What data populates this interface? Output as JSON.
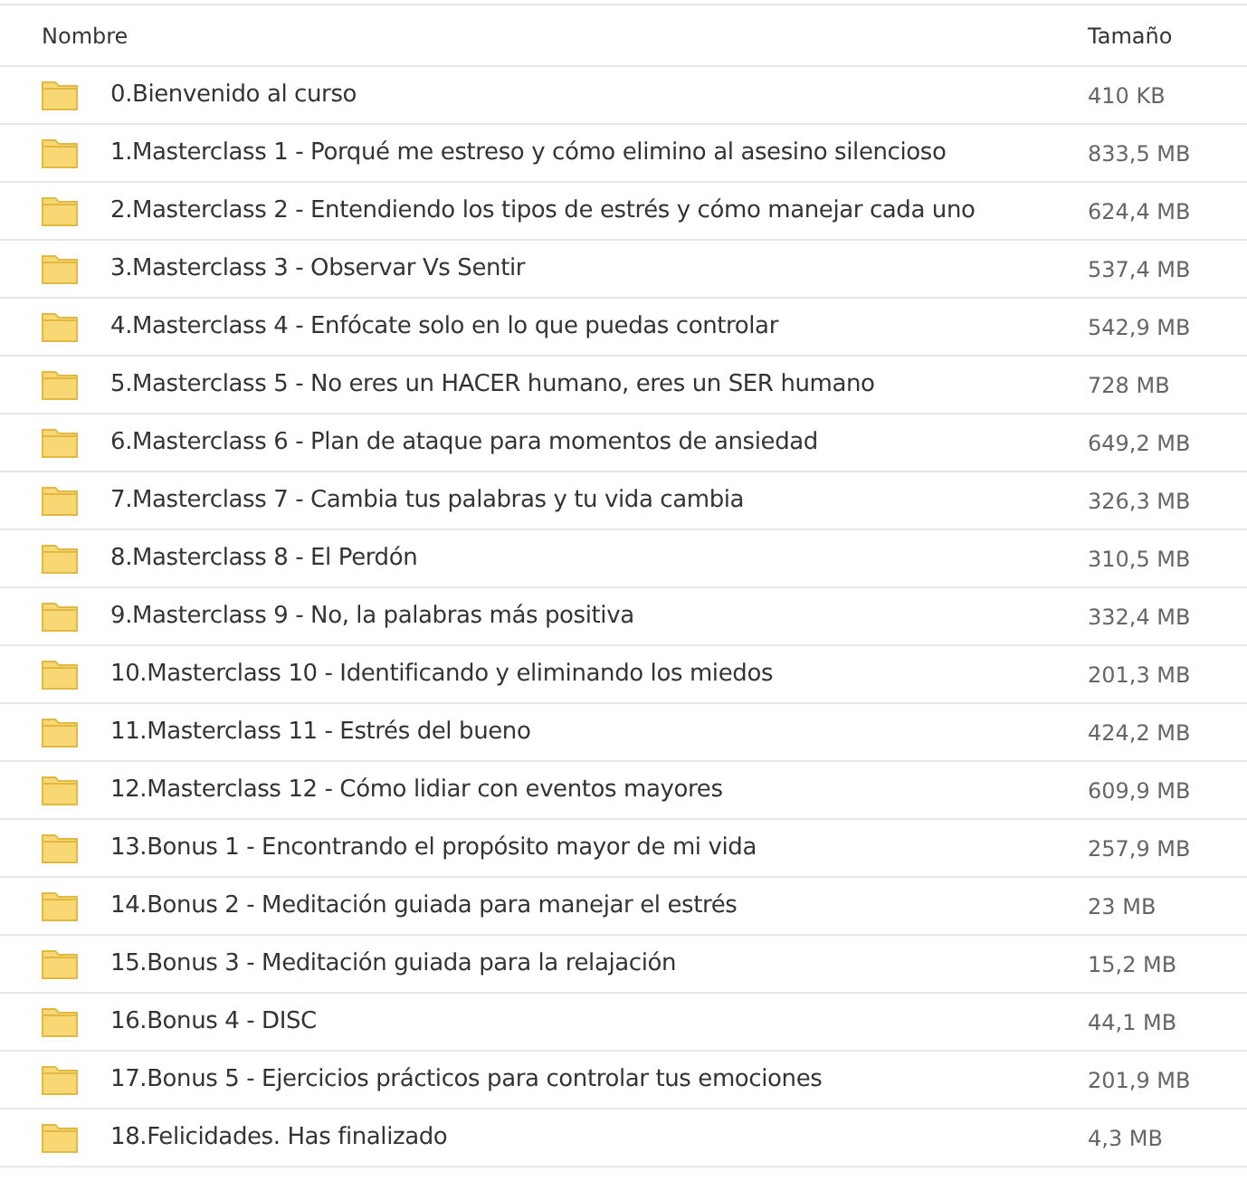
{
  "columns": [
    "Nombre",
    "Tamaño"
  ],
  "rows": [
    {
      "name": "0.Bienvenido al curso",
      "size": "410 KB"
    },
    {
      "name": "1.Masterclass 1 - Porqué me estreso y cómo elimino al asesino silencioso",
      "size": "833,5 MB"
    },
    {
      "name": "2.Masterclass 2 - Entendiendo los tipos de estrés y cómo manejar cada uno",
      "size": "624,4 MB"
    },
    {
      "name": "3.Masterclass 3 - Observar Vs Sentir",
      "size": "537,4 MB"
    },
    {
      "name": "4.Masterclass 4 - Enfócate solo en lo que puedas controlar",
      "size": "542,9 MB"
    },
    {
      "name": "5.Masterclass 5 - No eres un HACER humano, eres un SER humano",
      "size": "728 MB"
    },
    {
      "name": "6.Masterclass 6 - Plan de ataque para momentos de ansiedad",
      "size": "649,2 MB"
    },
    {
      "name": "7.Masterclass 7 - Cambia tus palabras y tu vida cambia",
      "size": "326,3 MB"
    },
    {
      "name": "8.Masterclass 8 - El Perdón",
      "size": "310,5 MB"
    },
    {
      "name": "9.Masterclass 9 - No, la palabras más positiva",
      "size": "332,4 MB"
    },
    {
      "name": "10.Masterclass 10 - Identificando y eliminando los miedos",
      "size": "201,3 MB"
    },
    {
      "name": "11.Masterclass 11 - Estrés del bueno",
      "size": "424,2 MB"
    },
    {
      "name": "12.Masterclass 12 - Cómo lidiar con eventos mayores",
      "size": "609,9 MB"
    },
    {
      "name": "13.Bonus 1 - Encontrando el propósito mayor de mi vida",
      "size": "257,9 MB"
    },
    {
      "name": "14.Bonus 2 - Meditación guiada para manejar el estrés",
      "size": "23 MB"
    },
    {
      "name": "15.Bonus 3 - Meditación guiada para la relajación",
      "size": "15,2 MB"
    },
    {
      "name": "16.Bonus 4 - DISC",
      "size": "44,1 MB"
    },
    {
      "name": "17.Bonus 5 - Ejercicios prácticos para controlar tus emociones",
      "size": "201,9 MB"
    },
    {
      "name": "18.Felicidades. Has finalizado",
      "size": "4,3 MB"
    }
  ]
}
